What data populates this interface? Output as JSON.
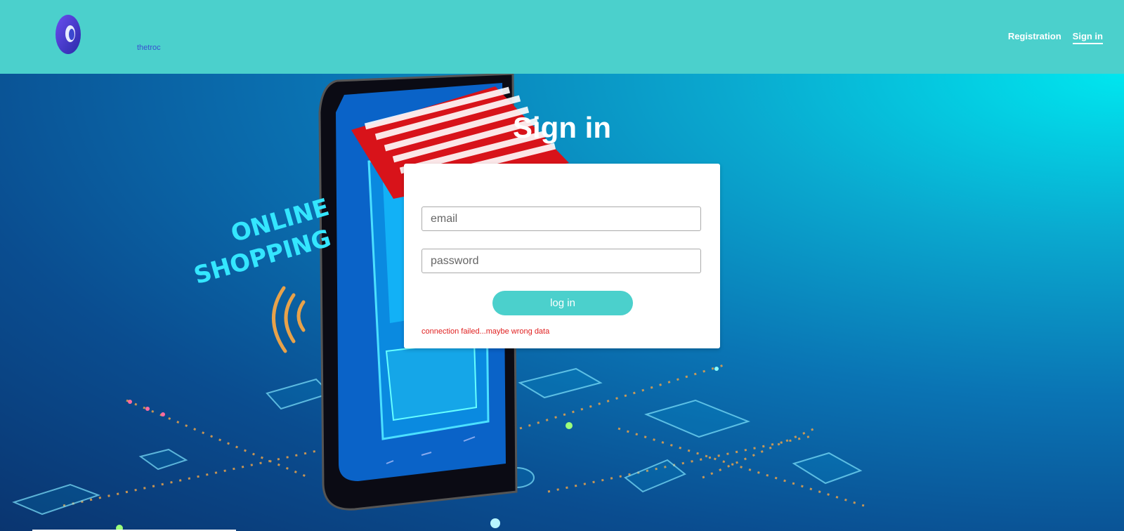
{
  "brand": {
    "name": "thetroc"
  },
  "nav": {
    "registration": "Registration",
    "signin": "Sign in"
  },
  "page": {
    "title": "Sign in"
  },
  "form": {
    "email_placeholder": "email",
    "password_placeholder": "password",
    "login_label": "log in",
    "error": "connection failed...maybe wrong data"
  },
  "hero": {
    "line1": "ONLINE",
    "line2": "SHOPPING"
  },
  "colors": {
    "accent": "#4bd0cc",
    "error": "#e02020",
    "white": "#ffffff"
  }
}
